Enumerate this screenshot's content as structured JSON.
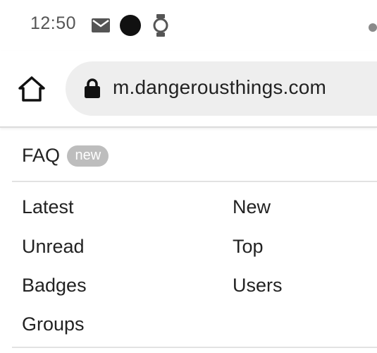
{
  "status_bar": {
    "time": "12:50",
    "icons": [
      "mail-icon",
      "dot-icon",
      "watch-icon"
    ]
  },
  "address_bar": {
    "url": "m.dangerousthings.com",
    "icons": [
      "home-icon",
      "lock-icon"
    ]
  },
  "menu": {
    "faq": {
      "label": "FAQ",
      "badge": "new"
    },
    "links": {
      "latest": "Latest",
      "new": "New",
      "unread": "Unread",
      "top": "Top",
      "badges": "Badges",
      "users": "Users",
      "groups": "Groups"
    }
  },
  "colors": {
    "text": "#222222",
    "status_text": "#555555",
    "url_pill": "#eeeeee",
    "badge_bg": "#bdbdbd"
  }
}
